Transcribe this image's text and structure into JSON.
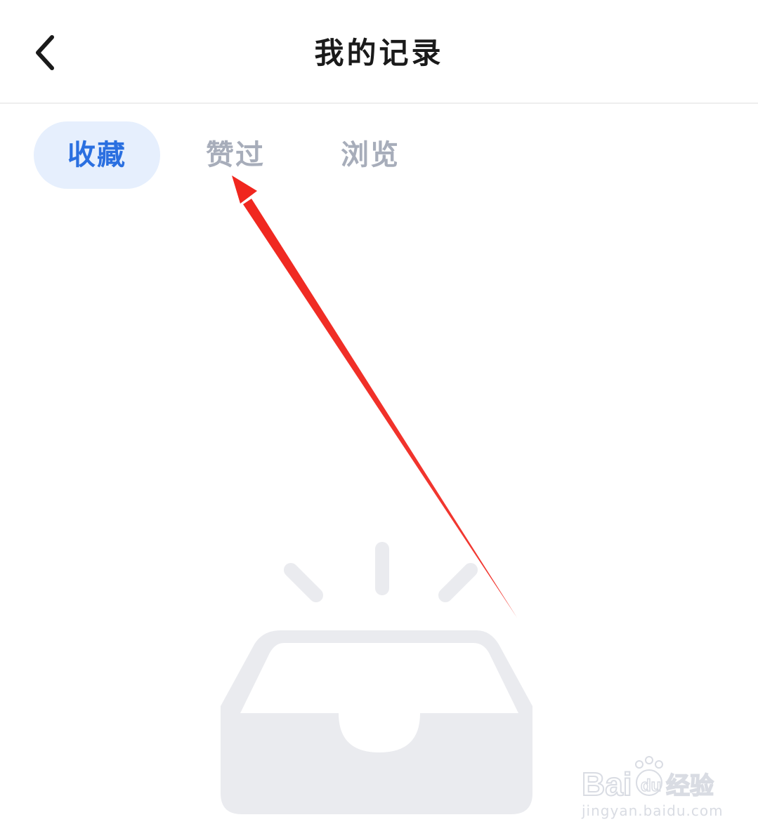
{
  "header": {
    "title": "我的记录",
    "back_icon": "chevron-left-icon"
  },
  "tabs": [
    {
      "label": "收藏",
      "active": true
    },
    {
      "label": "赞过",
      "active": false
    },
    {
      "label": "浏览",
      "active": false
    }
  ],
  "colors": {
    "active_tab_bg": "#e6effd",
    "active_tab_text": "#2a6fe0",
    "inactive_tab_text": "#a7adba",
    "annotation_arrow": "#f0261e",
    "empty_illustration": "#eaebef"
  },
  "empty_state": {
    "icon": "empty-inbox-icon"
  },
  "watermark": {
    "logo_text": "Bai百度经验",
    "url": "jingyan.baidu.com"
  }
}
